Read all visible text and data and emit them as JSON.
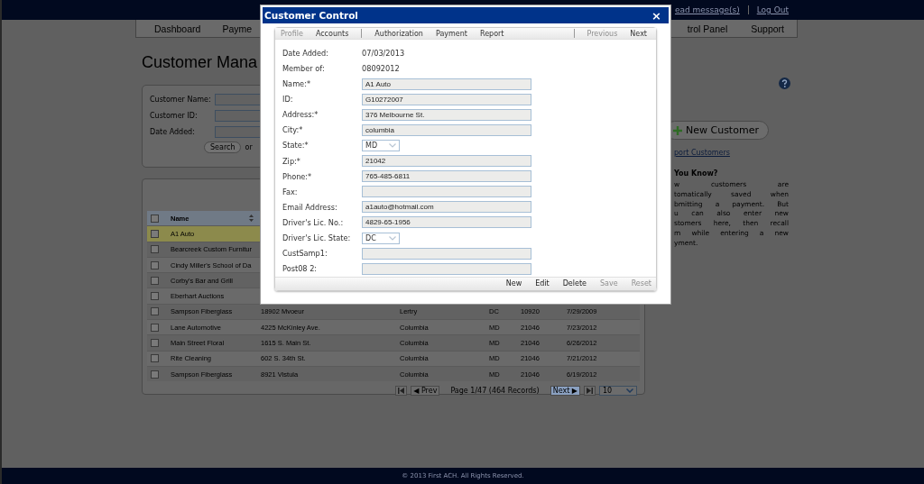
{
  "top_bar": {
    "links": [
      {
        "label": "ead message(s)"
      },
      {
        "label": "Log Out"
      }
    ]
  },
  "nav": {
    "items": [
      {
        "label": "Dashboard"
      },
      {
        "label": "Payme"
      },
      {
        "label": "trol Panel"
      },
      {
        "label": "Support"
      }
    ]
  },
  "page_title": "Customer Mana",
  "search": {
    "fields": [
      {
        "label": "Customer Name:"
      },
      {
        "label": "Customer ID:"
      },
      {
        "label": "Date Added:"
      }
    ],
    "button": "Search",
    "or_text": "or"
  },
  "table": {
    "columns": [
      "Name"
    ],
    "header_checked": false,
    "rows": [
      {
        "checked": false,
        "selected": true,
        "name": "A1 Auto"
      },
      {
        "checked": false,
        "selected": false,
        "name": "Bearcreek Custom Furnitur"
      },
      {
        "checked": false,
        "selected": false,
        "name": "Cindy Miller's School of Da"
      },
      {
        "checked": false,
        "selected": false,
        "name": "Corby's Bar and Grill"
      },
      {
        "checked": false,
        "selected": false,
        "name": "Eberhart Auctions"
      },
      {
        "checked": false,
        "selected": false,
        "name": "Sampson Fiberglass",
        "address": "18902 Mvoeur",
        "city": "Lertry",
        "state": "DC",
        "zip": "10920",
        "date_added": "7/29/2009"
      },
      {
        "checked": false,
        "selected": false,
        "name": "Lane Automotive",
        "address": "4225 McKinley Ave.",
        "city": "Columbia",
        "state": "MD",
        "zip": "21046",
        "date_added": "7/23/2012"
      },
      {
        "checked": false,
        "selected": false,
        "name": "Main Street Floral",
        "address": "1615 S. Main St.",
        "city": "Columbia",
        "state": "MD",
        "zip": "21046",
        "date_added": "6/26/2012"
      },
      {
        "checked": false,
        "selected": false,
        "name": "Rite Cleaning",
        "address": "602 S. 34th St.",
        "city": "Columbia",
        "state": "MD",
        "zip": "21046",
        "date_added": "7/21/2012"
      },
      {
        "checked": false,
        "selected": false,
        "name": "Sampson Fiberglass",
        "address": "8921 Vistula",
        "city": "Columbia",
        "state": "MD",
        "zip": "21046",
        "date_added": "6/19/2012"
      }
    ],
    "pager": {
      "prev": "◀ Prev",
      "info": "Page 1/47 (464 Records)",
      "next": "Next ▶",
      "page_size": "10"
    }
  },
  "sidebar": {
    "new_button": "New Customer",
    "link": "port Customers",
    "tip_title": "You Know?",
    "tip_lines": [
      "w customers are",
      "tomatically saved when",
      "bmitting a payment. But",
      "u can also enter new",
      "stomers here, then recall",
      "m while entering a new",
      "yment."
    ]
  },
  "dialog": {
    "title": "Customer Control",
    "close": "×",
    "tab_groups": [
      [
        {
          "label": "Profile",
          "disabled": true
        },
        {
          "label": "Accounts",
          "disabled": false
        }
      ],
      [
        {
          "label": "Authorization",
          "disabled": false
        },
        {
          "label": "Payment",
          "disabled": false
        },
        {
          "label": "Report",
          "disabled": false
        }
      ]
    ],
    "nav_buttons": [
      {
        "label": "Previous",
        "disabled": true
      },
      {
        "label": "Next",
        "disabled": false
      }
    ],
    "fields": [
      {
        "kind": "static",
        "label": "Date Added:",
        "value": "07/03/2013"
      },
      {
        "kind": "static",
        "label": "Member of:",
        "value": "08092012"
      },
      {
        "kind": "input",
        "label": "Name:*",
        "value": "A1 Auto"
      },
      {
        "kind": "input",
        "label": "ID:",
        "value": "G10272007"
      },
      {
        "kind": "input",
        "label": "Address:*",
        "value": "376 Melbourne St."
      },
      {
        "kind": "input",
        "label": "City:*",
        "value": "columbia"
      },
      {
        "kind": "select",
        "label": "State:*",
        "value": "MD"
      },
      {
        "kind": "input",
        "label": "Zip:*",
        "value": "21042"
      },
      {
        "kind": "input",
        "label": "Phone:*",
        "value": "765-485-6811"
      },
      {
        "kind": "input",
        "label": "Fax:"
      },
      {
        "kind": "input",
        "label": "Email Address:",
        "value": "a1auto@hotmail.com"
      },
      {
        "kind": "input",
        "label": "Driver's Lic. No.:",
        "value": "4829-65-1956"
      },
      {
        "kind": "select",
        "label": "Driver's Lic. State:",
        "value": "DC"
      },
      {
        "kind": "input",
        "label": "CustSamp1:"
      },
      {
        "kind": "input",
        "label": "Post08 2:"
      }
    ],
    "actions": [
      {
        "label": "New",
        "disabled": false
      },
      {
        "label": "Edit",
        "disabled": false
      },
      {
        "label": "Delete",
        "disabled": false
      },
      {
        "label": "Save",
        "disabled": true
      },
      {
        "label": "Reset",
        "disabled": true
      }
    ]
  },
  "footer": "© 2013 First ACH. All Rights Reserved."
}
